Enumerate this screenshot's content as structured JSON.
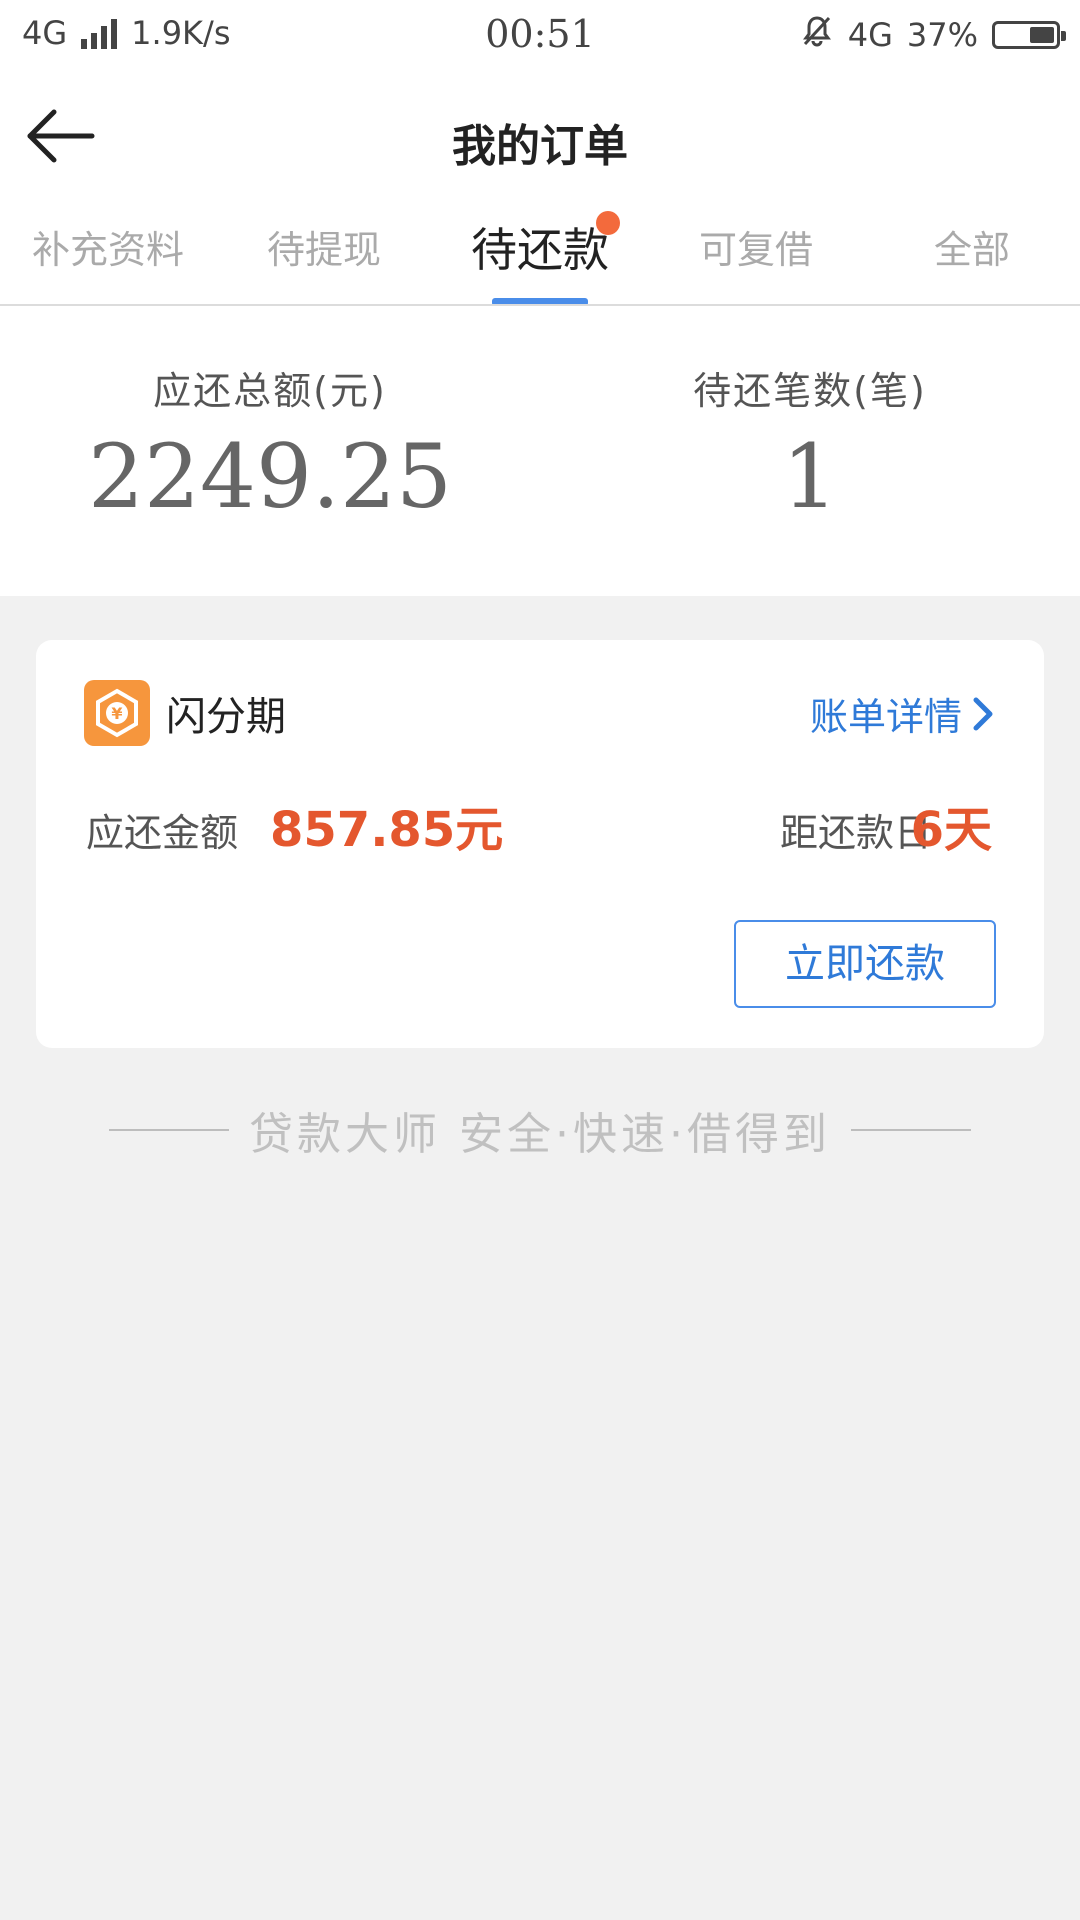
{
  "status_bar": {
    "network_left": "4G",
    "speed": "1.9K/s",
    "time": "00:51",
    "network_right": "4G",
    "battery": "37%"
  },
  "header": {
    "title": "我的订单"
  },
  "tabs": [
    {
      "label": "补充资料",
      "active": false
    },
    {
      "label": "待提现",
      "active": false
    },
    {
      "label": "待还款",
      "active": true
    },
    {
      "label": "可复借",
      "active": false
    },
    {
      "label": "全部",
      "active": false
    }
  ],
  "summary": {
    "total_label": "应还总额(元)",
    "total_value": "2249.25",
    "count_label": "待还笔数(笔)",
    "count_value": "1"
  },
  "order_card": {
    "brand_name": "闪分期",
    "bill_detail_label": "账单详情",
    "due_label": "应还金额",
    "due_amount": "857.85元",
    "days_label": "距还款日",
    "days_value": "6天",
    "repay_button": "立即还款"
  },
  "footer": {
    "slogan": "贷款大师 安全·快速·借得到"
  },
  "colors": {
    "accent_blue": "#4a8de9",
    "link_blue": "#2f7ad8",
    "alert_red": "#e4572e",
    "badge_dot": "#f36a3c",
    "brand_orange": "#f6963d"
  }
}
